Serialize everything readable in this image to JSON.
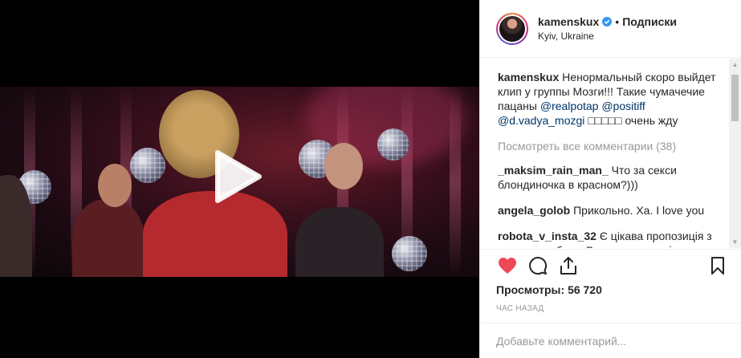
{
  "header": {
    "username": "kamenskux",
    "follow_label": "Подписки",
    "dot": "•",
    "location": "Kyiv, Ukraine"
  },
  "caption": {
    "username": "kamenskux",
    "text": " Ненормальный скоро выйдет клип у группы Мозги!!! Такие чумачечие пацаны ",
    "mentions": [
      "@realpotap",
      "@positiff",
      "@d.vadya_mozgi"
    ],
    "tail": " □□□□□ очень жду"
  },
  "view_all_comments": "Посмотреть все комментарии (38)",
  "comments": [
    {
      "username": "_maksim_rain_man_",
      "text": " Что за секси блондиночка в красном?)))"
    },
    {
      "username": "angela_golob",
      "text": " Прикольно. Ха. I love you"
    },
    {
      "username": "robota_v_insta_32",
      "text": " Є цікава пропозиція з приводу роботи. Все дуже легко і просто. Випрете не пожалкуєте ➖ Графік"
    }
  ],
  "actions": {
    "views_label": "Просмотры:",
    "views_count": "56 720",
    "timestamp": "час назад",
    "like_color": "#ed4956"
  },
  "add_comment": {
    "placeholder": "Добавьте комментарий..."
  },
  "icons": {
    "play": "play-icon",
    "verified": "verified-badge-icon",
    "like": "heart-icon",
    "comment": "comment-icon",
    "share": "share-icon",
    "save": "bookmark-icon"
  }
}
